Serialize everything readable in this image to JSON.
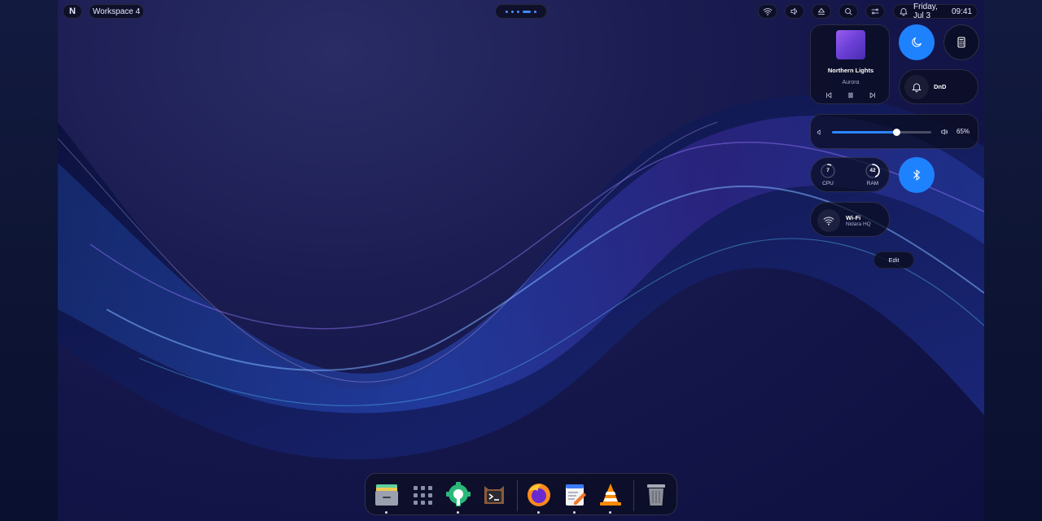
{
  "topbar": {
    "logo": "N",
    "workspace": "Workspace 4",
    "workspace_dots": 5,
    "active_workspace_index": 3,
    "status_icons": [
      "wifi-icon",
      "volume-icon",
      "eject-icon",
      "search-icon",
      "sliders-icon"
    ],
    "notification_icon": "bell-icon",
    "date": "Friday, Jul 3",
    "time": "09:41"
  },
  "media": {
    "title": "Northern Lights",
    "artist": "Aurora",
    "controls": [
      "previous-icon",
      "pause-icon",
      "next-icon"
    ]
  },
  "quick_toggles": {
    "night_light": {
      "icon": "moon-icon",
      "active": true
    },
    "calculator": {
      "icon": "calculator-icon",
      "active": false
    },
    "bluetooth": {
      "icon": "bluetooth-icon",
      "active": true
    },
    "dnd": {
      "label": "DnD",
      "icon": "bell-icon",
      "active": false
    }
  },
  "volume": {
    "value": 65,
    "display": "65%"
  },
  "system": {
    "cpu": {
      "value": "7",
      "label": "CPU",
      "percent": 7
    },
    "ram": {
      "value": "42",
      "label": "RAM",
      "percent": 42
    }
  },
  "wifi": {
    "label": "Wi-Fi",
    "network": "Nidara HQ"
  },
  "edit_label": "Edit",
  "dock": {
    "apps": [
      {
        "name": "files",
        "running": true
      },
      {
        "name": "app-grid",
        "running": false
      },
      {
        "name": "settings",
        "running": true
      },
      {
        "name": "terminal",
        "running": false
      },
      {
        "name": "firefox",
        "running": true
      },
      {
        "name": "text-editor",
        "running": true
      },
      {
        "name": "vlc",
        "running": true
      },
      {
        "name": "trash",
        "running": false
      }
    ]
  },
  "colors": {
    "accent": "#1e82ff",
    "background": "#14164a"
  }
}
